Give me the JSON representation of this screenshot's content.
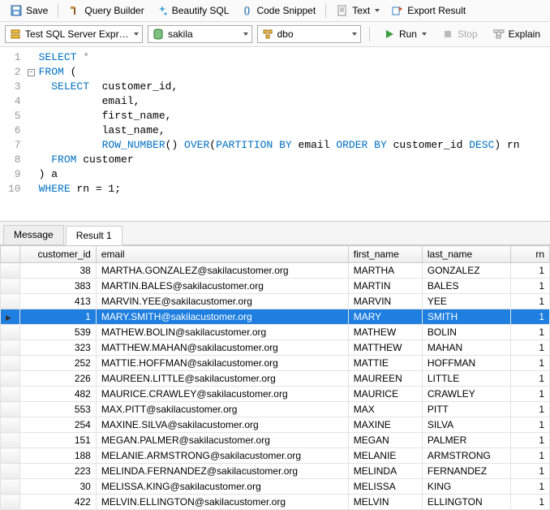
{
  "toolbar": {
    "save": "Save",
    "query_builder": "Query Builder",
    "beautify_sql": "Beautify SQL",
    "code_snippet": "Code Snippet",
    "text": "Text",
    "export_result": "Export Result"
  },
  "connbar": {
    "connection": "Test SQL Server Expres",
    "database": "sakila",
    "schema": "dbo",
    "run": "Run",
    "stop": "Stop",
    "explain": "Explain"
  },
  "sql": {
    "lines": [
      "SELECT *",
      "FROM (",
      "  SELECT  customer_id,",
      "          email,",
      "          first_name,",
      "          last_name,",
      "          ROW_NUMBER() OVER(PARTITION BY email ORDER BY customer_id DESC) rn",
      "  FROM customer",
      ") a",
      "WHERE rn = 1;"
    ]
  },
  "tabs": {
    "message": "Message",
    "result1": "Result 1"
  },
  "grid": {
    "columns": [
      "customer_id",
      "email",
      "first_name",
      "last_name",
      "rn"
    ],
    "selected_index": 3,
    "rows": [
      {
        "customer_id": 38,
        "email": "MARTHA.GONZALEZ@sakilacustomer.org",
        "first_name": "MARTHA",
        "last_name": "GONZALEZ",
        "rn": 1
      },
      {
        "customer_id": 383,
        "email": "MARTIN.BALES@sakilacustomer.org",
        "first_name": "MARTIN",
        "last_name": "BALES",
        "rn": 1
      },
      {
        "customer_id": 413,
        "email": "MARVIN.YEE@sakilacustomer.org",
        "first_name": "MARVIN",
        "last_name": "YEE",
        "rn": 1
      },
      {
        "customer_id": 1,
        "email": "MARY.SMITH@sakilacustomer.org",
        "first_name": "MARY",
        "last_name": "SMITH",
        "rn": 1
      },
      {
        "customer_id": 539,
        "email": "MATHEW.BOLIN@sakilacustomer.org",
        "first_name": "MATHEW",
        "last_name": "BOLIN",
        "rn": 1
      },
      {
        "customer_id": 323,
        "email": "MATTHEW.MAHAN@sakilacustomer.org",
        "first_name": "MATTHEW",
        "last_name": "MAHAN",
        "rn": 1
      },
      {
        "customer_id": 252,
        "email": "MATTIE.HOFFMAN@sakilacustomer.org",
        "first_name": "MATTIE",
        "last_name": "HOFFMAN",
        "rn": 1
      },
      {
        "customer_id": 226,
        "email": "MAUREEN.LITTLE@sakilacustomer.org",
        "first_name": "MAUREEN",
        "last_name": "LITTLE",
        "rn": 1
      },
      {
        "customer_id": 482,
        "email": "MAURICE.CRAWLEY@sakilacustomer.org",
        "first_name": "MAURICE",
        "last_name": "CRAWLEY",
        "rn": 1
      },
      {
        "customer_id": 553,
        "email": "MAX.PITT@sakilacustomer.org",
        "first_name": "MAX",
        "last_name": "PITT",
        "rn": 1
      },
      {
        "customer_id": 254,
        "email": "MAXINE.SILVA@sakilacustomer.org",
        "first_name": "MAXINE",
        "last_name": "SILVA",
        "rn": 1
      },
      {
        "customer_id": 151,
        "email": "MEGAN.PALMER@sakilacustomer.org",
        "first_name": "MEGAN",
        "last_name": "PALMER",
        "rn": 1
      },
      {
        "customer_id": 188,
        "email": "MELANIE.ARMSTRONG@sakilacustomer.org",
        "first_name": "MELANIE",
        "last_name": "ARMSTRONG",
        "rn": 1
      },
      {
        "customer_id": 223,
        "email": "MELINDA.FERNANDEZ@sakilacustomer.org",
        "first_name": "MELINDA",
        "last_name": "FERNANDEZ",
        "rn": 1
      },
      {
        "customer_id": 30,
        "email": "MELISSA.KING@sakilacustomer.org",
        "first_name": "MELISSA",
        "last_name": "KING",
        "rn": 1
      },
      {
        "customer_id": 422,
        "email": "MELVIN.ELLINGTON@sakilacustomer.org",
        "first_name": "MELVIN",
        "last_name": "ELLINGTON",
        "rn": 1
      }
    ]
  }
}
